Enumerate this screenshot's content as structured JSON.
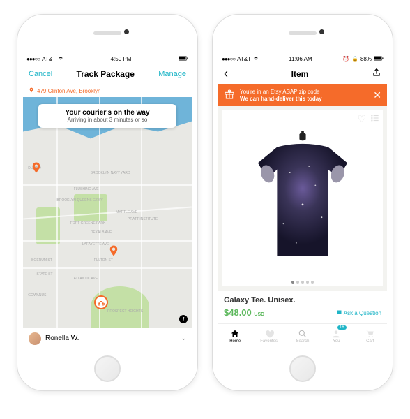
{
  "left": {
    "status": {
      "carrier": "AT&T",
      "time": "4:50 PM"
    },
    "nav": {
      "cancel": "Cancel",
      "title": "Track Package",
      "manage": "Manage"
    },
    "address": "479 Clinton Ave, Brooklyn",
    "bubble": {
      "title": "Your courier's on the way",
      "subtitle": "Arriving in about 3 minutes or so"
    },
    "map_labels": {
      "dumbo": "DUMBO",
      "navy": "Brooklyn Navy Yard",
      "flushing": "FLUSHING AVE",
      "bkexwy": "BROOKLYN-QUEENS EXWY",
      "myrtle": "MYRTLE AVE",
      "ftgreene": "Fort Greene Park",
      "pratt": "Pratt Institute",
      "dekalb": "DEKALB AVE",
      "lafayette": "LAFAYETTE AVE",
      "fulton": "FULTON ST",
      "atlantic": "ATLANTIC AVE",
      "gowanus": "Gowanus",
      "prospect": "Prospect Heights",
      "boerum": "BOERUM ST",
      "statest": "STATE ST"
    },
    "courier": "Ronella W."
  },
  "right": {
    "status": {
      "carrier": "AT&T",
      "time": "11:06 AM",
      "battery": "88%"
    },
    "nav": {
      "title": "Item"
    },
    "banner": {
      "line1": "You're in an Etsy ASAP zip code",
      "line2": "We can hand-deliver this today"
    },
    "item": {
      "title": "Galaxy Tee. Unisex.",
      "price": "$48.00",
      "currency": "USD",
      "ask": "Ask a Question"
    },
    "tabs": {
      "home": "Home",
      "favorites": "Favorites",
      "search": "Search",
      "you": "You",
      "cart": "Cart",
      "you_badge": "16"
    }
  },
  "colors": {
    "accent_orange": "#f56b2a",
    "teal": "#1fb5c7",
    "green": "#5cb85c"
  }
}
